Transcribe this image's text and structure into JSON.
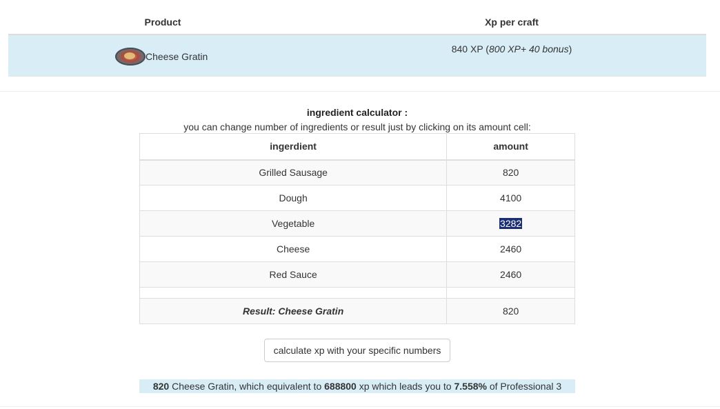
{
  "product_table": {
    "headers": {
      "product": "Product",
      "xp": "Xp per craft"
    },
    "row": {
      "icon": "cheese-gratin-dish-icon",
      "name": "Cheese Gratin",
      "xp_prefix": "840 XP (",
      "xp_detail": "800 XP+ 40 bonus",
      "xp_suffix": ")"
    }
  },
  "calculator": {
    "title": "ingredient calculator :",
    "subtitle": "you can change number of ingredients or result just by clicking on its amount cell:",
    "headers": {
      "name": "ingerdient",
      "amount": "amount"
    },
    "rows": [
      {
        "name": "Grilled Sausage",
        "amount": "820"
      },
      {
        "name": "Dough",
        "amount": "4100"
      },
      {
        "name": "Vegetable",
        "amount": "3282"
      },
      {
        "name": "Cheese",
        "amount": "2460"
      },
      {
        "name": "Red Sauce",
        "amount": "2460"
      }
    ],
    "result": {
      "label": "Result: Cheese Gratin",
      "amount": "820"
    },
    "button_label": "calculate xp with your specific numbers"
  },
  "summary": {
    "count": "820",
    "text1": " Cheese Gratin, which equivalent to ",
    "xp": "688800",
    "text2": " xp which leads you to ",
    "percent": "7.558%",
    "text3": " of Professional 3"
  },
  "colors": {
    "highlight_row": "#d9edf7",
    "selection": "#1b2f72"
  }
}
